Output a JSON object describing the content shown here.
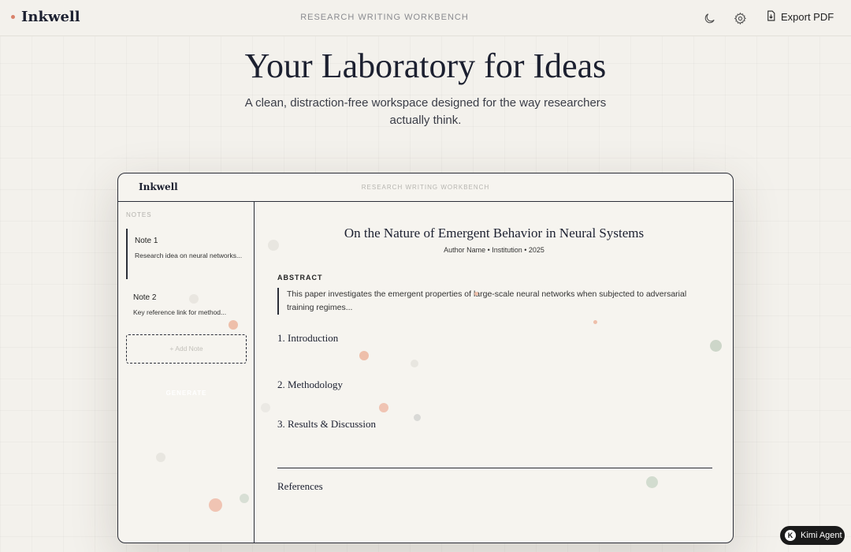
{
  "nav": {
    "brand": "Inkwell",
    "center_label": "RESEARCH WRITING WORKBENCH",
    "theme_icon": "moon-icon",
    "settings_icon": "gear-icon",
    "export_icon": "document-download-icon",
    "export_label": "Export PDF"
  },
  "hero": {
    "title": "Your Laboratory for Ideas",
    "subtitle": "A clean, distraction-free workspace designed for the way researchers actually think."
  },
  "mock": {
    "brand": "Inkwell",
    "center_label": "RESEARCH WRITING WORKBENCH",
    "sidebar": {
      "notes_label": "NOTES",
      "notes": [
        {
          "title": "Note 1",
          "body": "Research idea on neural networks..."
        },
        {
          "title": "Note 2",
          "body": "Key reference link for method..."
        }
      ],
      "add_note_label": "+ Add Note",
      "generate_label": "GENERATE"
    },
    "paper": {
      "title": "On the Nature of Emergent Behavior in Neural Systems",
      "meta": "Author Name • Institution • 2025",
      "abstract_label": "ABSTRACT",
      "abstract_text": "This paper investigates the emergent properties of large-scale neural networks when subjected to adversarial training regimes...",
      "sections": [
        "1. Introduction",
        "2. Methodology",
        "3. Results & Discussion"
      ],
      "references_label": "References"
    }
  },
  "badge": {
    "logo": "K",
    "label": "Kimi Agent"
  },
  "colors": {
    "accent_dot": "#d9826a",
    "ink": "#1c2030",
    "background": "#f3f1ec"
  }
}
